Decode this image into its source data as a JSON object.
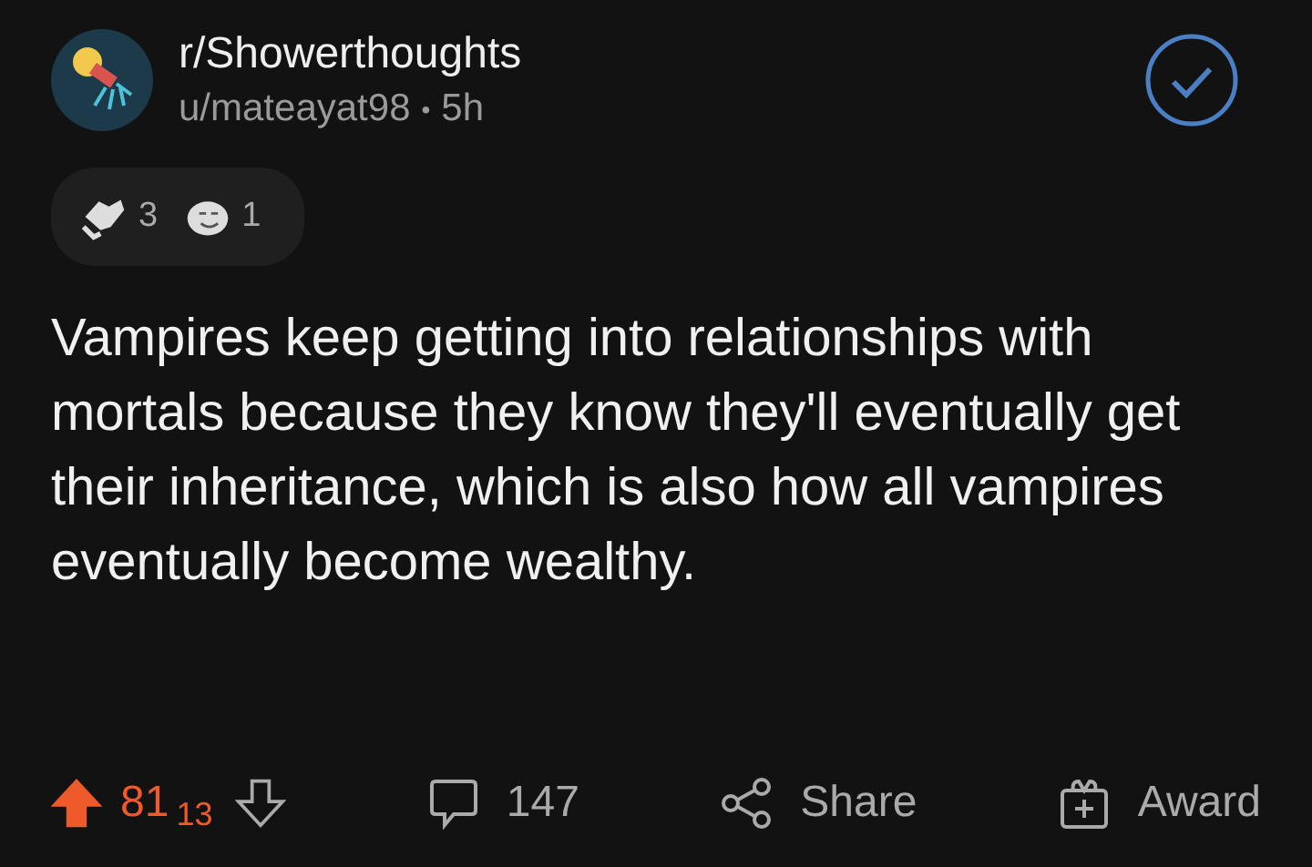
{
  "post": {
    "subreddit": "r/Showerthoughts",
    "author": "u/mateayat98",
    "separator": "•",
    "age": "5h",
    "joined": true,
    "awards": [
      {
        "kind": "handshake",
        "count": "3"
      },
      {
        "kind": "laugh",
        "count": "1"
      }
    ],
    "text": "Vampires keep getting into relationships with mortals because they know they'll eventually get their inheritance, which is also how all vampires eventually become wealthy."
  },
  "actions": {
    "upvoted": true,
    "score": "81",
    "score_rolling": "13",
    "comments": "147",
    "share": "Share",
    "award": "Award"
  }
}
